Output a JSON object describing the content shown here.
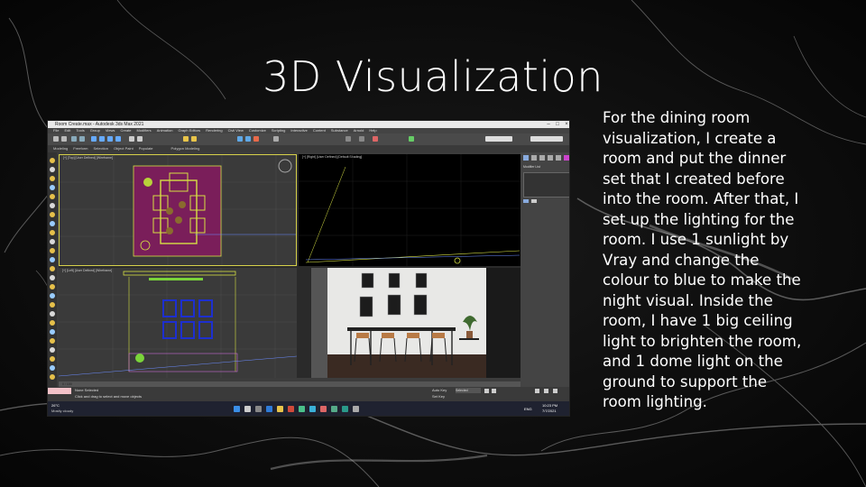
{
  "slide": {
    "title": "3D Visualization",
    "description_lines": [
      "For the dining room",
      "visualization, I create a",
      "room and put the dinner",
      "set that I created before",
      "into the room. After that, I",
      "set up the lighting for the",
      "room. I use 1 sunlight by",
      "Vray and change the",
      "colour to blue to make the",
      "night visual. Inside the",
      "room, I have 1 big ceiling",
      "light to brighten the room,",
      "and 1 dome light on the",
      "ground to support the",
      "room lighting."
    ]
  },
  "app": {
    "window_title": "Room Create.max - Autodesk 3ds Max 2021",
    "menu": [
      "File",
      "Edit",
      "Tools",
      "Group",
      "Views",
      "Create",
      "Modifiers",
      "Animation",
      "Graph Editors",
      "Rendering",
      "Civil View",
      "Customize",
      "Scripting",
      "Interactive",
      "Content",
      "Substance",
      "Arnold",
      "Help"
    ],
    "ribbon": [
      "Modeling",
      "Freeform",
      "Selection",
      "Object Paint",
      "Populate"
    ],
    "ribbon_sub": "Polygon Modeling",
    "viewports": {
      "top": "[+] [Top] [User Defined] [Wireframe]",
      "right": "[+] [Right] [User Defined] [Default Shading]",
      "left": "[+] [Left] [User Defined] [Wireframe]",
      "camera": "[+] [Camera001] [User Defined] [Default Shading]"
    },
    "panel_title": "Modifier List",
    "timeline": "0 / 100",
    "status": {
      "selection": "None Selected",
      "hint": "Click and drag to select and move objects",
      "auto_key": "Auto Key",
      "set_key": "Set Key",
      "selected_label": "Selected"
    },
    "taskbar": {
      "weather_temp": "26°C",
      "weather_desc": "Mostly cloudy",
      "lang": "ENG",
      "time": "10:23 PM",
      "date": "7/7/2021"
    }
  },
  "colors": {
    "accent_yellow": "#d6e043",
    "plan_magenta": "#7a1e5a",
    "window_blue": "#1d2fcf"
  }
}
